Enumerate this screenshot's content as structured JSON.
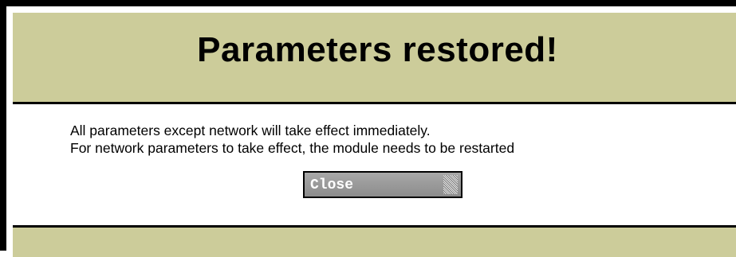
{
  "dialog": {
    "title": "Parameters restored!",
    "message_line1": "All parameters except network will take effect immediately.",
    "message_line2": "For network parameters to take effect, the module needs to be restarted",
    "close_label": "Close"
  },
  "colors": {
    "panel": "#cccc9a",
    "border": "#000000",
    "button": "#999999",
    "button_text": "#ffffff"
  }
}
